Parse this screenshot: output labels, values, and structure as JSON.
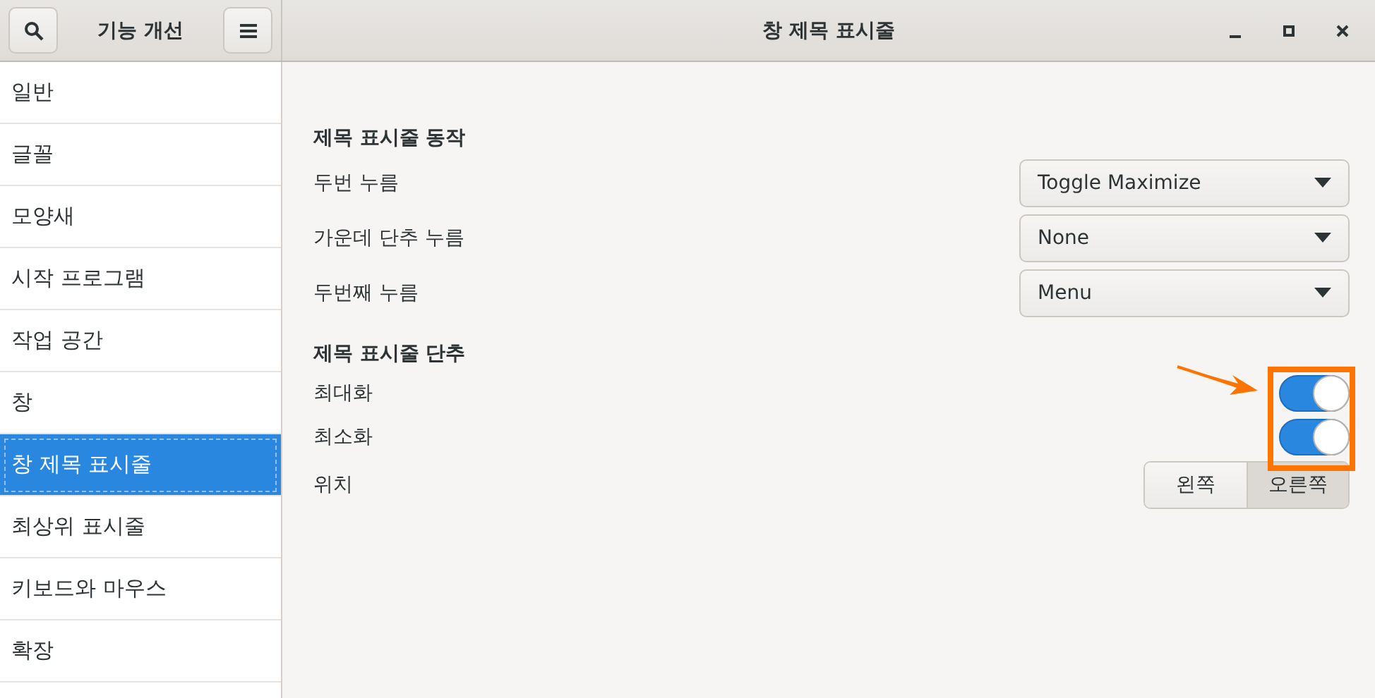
{
  "header": {
    "title": "기능 개선",
    "main_title": "창 제목 표시줄"
  },
  "sidebar": {
    "items": [
      {
        "label": "일반",
        "selected": false
      },
      {
        "label": "글꼴",
        "selected": false
      },
      {
        "label": "모양새",
        "selected": false
      },
      {
        "label": "시작 프로그램",
        "selected": false
      },
      {
        "label": "작업 공간",
        "selected": false
      },
      {
        "label": "창",
        "selected": false
      },
      {
        "label": "창 제목 표시줄",
        "selected": true
      },
      {
        "label": "최상위 표시줄",
        "selected": false
      },
      {
        "label": "키보드와 마우스",
        "selected": false
      },
      {
        "label": "확장",
        "selected": false
      }
    ]
  },
  "sections": [
    {
      "title": "제목 표시줄 동작",
      "rows": [
        {
          "kind": "combo",
          "label": "두번 누름",
          "value": "Toggle Maximize"
        },
        {
          "kind": "combo",
          "label": "가운데 단추 누름",
          "value": "None"
        },
        {
          "kind": "combo",
          "label": "두번째 누름",
          "value": "Menu"
        }
      ]
    },
    {
      "title": "제목 표시줄 단추",
      "rows": [
        {
          "kind": "switch",
          "label": "최대화",
          "on": true
        },
        {
          "kind": "switch",
          "label": "최소화",
          "on": true
        },
        {
          "kind": "segmented",
          "label": "위치",
          "options": [
            {
              "label": "왼쪽",
              "selected": false
            },
            {
              "label": "오른쪽",
              "selected": true
            }
          ]
        }
      ]
    }
  ]
}
